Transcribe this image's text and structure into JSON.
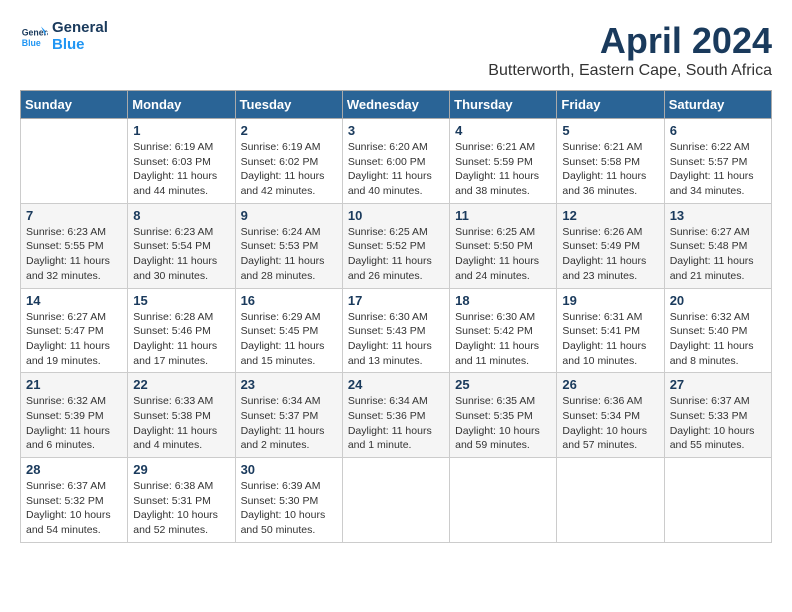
{
  "logo": {
    "line1": "General",
    "line2": "Blue"
  },
  "title": "April 2024",
  "location": "Butterworth, Eastern Cape, South Africa",
  "days_of_week": [
    "Sunday",
    "Monday",
    "Tuesday",
    "Wednesday",
    "Thursday",
    "Friday",
    "Saturday"
  ],
  "weeks": [
    [
      {
        "day": "",
        "info": ""
      },
      {
        "day": "1",
        "info": "Sunrise: 6:19 AM\nSunset: 6:03 PM\nDaylight: 11 hours\nand 44 minutes."
      },
      {
        "day": "2",
        "info": "Sunrise: 6:19 AM\nSunset: 6:02 PM\nDaylight: 11 hours\nand 42 minutes."
      },
      {
        "day": "3",
        "info": "Sunrise: 6:20 AM\nSunset: 6:00 PM\nDaylight: 11 hours\nand 40 minutes."
      },
      {
        "day": "4",
        "info": "Sunrise: 6:21 AM\nSunset: 5:59 PM\nDaylight: 11 hours\nand 38 minutes."
      },
      {
        "day": "5",
        "info": "Sunrise: 6:21 AM\nSunset: 5:58 PM\nDaylight: 11 hours\nand 36 minutes."
      },
      {
        "day": "6",
        "info": "Sunrise: 6:22 AM\nSunset: 5:57 PM\nDaylight: 11 hours\nand 34 minutes."
      }
    ],
    [
      {
        "day": "7",
        "info": "Sunrise: 6:23 AM\nSunset: 5:55 PM\nDaylight: 11 hours\nand 32 minutes."
      },
      {
        "day": "8",
        "info": "Sunrise: 6:23 AM\nSunset: 5:54 PM\nDaylight: 11 hours\nand 30 minutes."
      },
      {
        "day": "9",
        "info": "Sunrise: 6:24 AM\nSunset: 5:53 PM\nDaylight: 11 hours\nand 28 minutes."
      },
      {
        "day": "10",
        "info": "Sunrise: 6:25 AM\nSunset: 5:52 PM\nDaylight: 11 hours\nand 26 minutes."
      },
      {
        "day": "11",
        "info": "Sunrise: 6:25 AM\nSunset: 5:50 PM\nDaylight: 11 hours\nand 24 minutes."
      },
      {
        "day": "12",
        "info": "Sunrise: 6:26 AM\nSunset: 5:49 PM\nDaylight: 11 hours\nand 23 minutes."
      },
      {
        "day": "13",
        "info": "Sunrise: 6:27 AM\nSunset: 5:48 PM\nDaylight: 11 hours\nand 21 minutes."
      }
    ],
    [
      {
        "day": "14",
        "info": "Sunrise: 6:27 AM\nSunset: 5:47 PM\nDaylight: 11 hours\nand 19 minutes."
      },
      {
        "day": "15",
        "info": "Sunrise: 6:28 AM\nSunset: 5:46 PM\nDaylight: 11 hours\nand 17 minutes."
      },
      {
        "day": "16",
        "info": "Sunrise: 6:29 AM\nSunset: 5:45 PM\nDaylight: 11 hours\nand 15 minutes."
      },
      {
        "day": "17",
        "info": "Sunrise: 6:30 AM\nSunset: 5:43 PM\nDaylight: 11 hours\nand 13 minutes."
      },
      {
        "day": "18",
        "info": "Sunrise: 6:30 AM\nSunset: 5:42 PM\nDaylight: 11 hours\nand 11 minutes."
      },
      {
        "day": "19",
        "info": "Sunrise: 6:31 AM\nSunset: 5:41 PM\nDaylight: 11 hours\nand 10 minutes."
      },
      {
        "day": "20",
        "info": "Sunrise: 6:32 AM\nSunset: 5:40 PM\nDaylight: 11 hours\nand 8 minutes."
      }
    ],
    [
      {
        "day": "21",
        "info": "Sunrise: 6:32 AM\nSunset: 5:39 PM\nDaylight: 11 hours\nand 6 minutes."
      },
      {
        "day": "22",
        "info": "Sunrise: 6:33 AM\nSunset: 5:38 PM\nDaylight: 11 hours\nand 4 minutes."
      },
      {
        "day": "23",
        "info": "Sunrise: 6:34 AM\nSunset: 5:37 PM\nDaylight: 11 hours\nand 2 minutes."
      },
      {
        "day": "24",
        "info": "Sunrise: 6:34 AM\nSunset: 5:36 PM\nDaylight: 11 hours\nand 1 minute."
      },
      {
        "day": "25",
        "info": "Sunrise: 6:35 AM\nSunset: 5:35 PM\nDaylight: 10 hours\nand 59 minutes."
      },
      {
        "day": "26",
        "info": "Sunrise: 6:36 AM\nSunset: 5:34 PM\nDaylight: 10 hours\nand 57 minutes."
      },
      {
        "day": "27",
        "info": "Sunrise: 6:37 AM\nSunset: 5:33 PM\nDaylight: 10 hours\nand 55 minutes."
      }
    ],
    [
      {
        "day": "28",
        "info": "Sunrise: 6:37 AM\nSunset: 5:32 PM\nDaylight: 10 hours\nand 54 minutes."
      },
      {
        "day": "29",
        "info": "Sunrise: 6:38 AM\nSunset: 5:31 PM\nDaylight: 10 hours\nand 52 minutes."
      },
      {
        "day": "30",
        "info": "Sunrise: 6:39 AM\nSunset: 5:30 PM\nDaylight: 10 hours\nand 50 minutes."
      },
      {
        "day": "",
        "info": ""
      },
      {
        "day": "",
        "info": ""
      },
      {
        "day": "",
        "info": ""
      },
      {
        "day": "",
        "info": ""
      }
    ]
  ]
}
